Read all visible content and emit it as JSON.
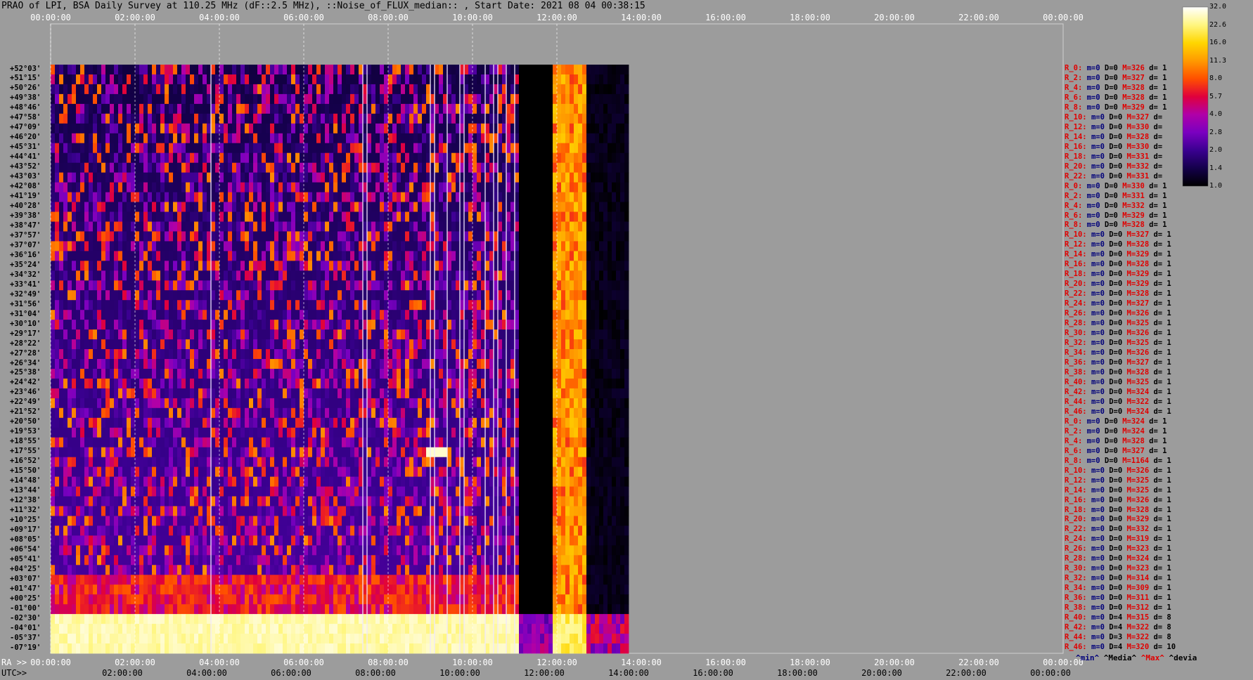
{
  "title": "PRAO of LPI, BSA Daily Survey at 110.25 MHz (dF::2.5 MHz), ::Noise_of_FLUX_median:: , Start Date: 2021 08 04 00:38:15",
  "axis": {
    "utc_top_ticks": [
      "00:00:00",
      "02:00:00",
      "04:00:00",
      "06:00:00",
      "08:00:00",
      "10:00:00",
      "12:00:00",
      "14:00:00",
      "16:00:00",
      "18:00:00",
      "20:00:00",
      "22:00:00",
      "00:00:00"
    ],
    "utc_bottom_prefix": "RA >>",
    "utc_bottom_ticks": [
      "00:00:00",
      "02:00:00",
      "04:00:00",
      "06:00:00",
      "08:00:00",
      "10:00:00",
      "12:00:00",
      "14:00:00",
      "16:00:00",
      "18:00:00",
      "20:00:00",
      "22:00:00",
      "00:00:00"
    ],
    "lst_prefix": "UTC>>",
    "lst_ticks": [
      "02:00:00",
      "04:00:00",
      "06:00:00",
      "08:00:00",
      "10:00:00",
      "12:00:00",
      "14:00:00",
      "16:00:00",
      "18:00:00",
      "20:00:00",
      "22:00:00",
      "00:00:00"
    ]
  },
  "declinations": [
    "+52°03'",
    "+51°15'",
    "+50°26'",
    "+49°38'",
    "+48°46'",
    "+47°58'",
    "+47°09'",
    "+46°20'",
    "+45°31'",
    "+44°41'",
    "+43°52'",
    "+43°03'",
    "+42°08'",
    "+41°19'",
    "+40°28'",
    "+39°38'",
    "+38°47'",
    "+37°57'",
    "+37°07'",
    "+36°16'",
    "+35°24'",
    "+34°32'",
    "+33°41'",
    "+32°49'",
    "+31°56'",
    "+31°04'",
    "+30°10'",
    "+29°17'",
    "+28°22'",
    "+27°28'",
    "+26°34'",
    "+25°38'",
    "+24°42'",
    "+23°46'",
    "+22°49'",
    "+21°52'",
    "+20°50'",
    "+19°53'",
    "+18°55'",
    "+17°55'",
    "+16°52'",
    "+15°50'",
    "+14°48'",
    "+13°44'",
    "+12°38'",
    "+11°32'",
    "+10°25'",
    "+09°17'",
    "+08°05'",
    "+06°54'",
    "+05°41'",
    "+04°25'",
    "+03°07'",
    "+01°47'",
    "+00°25'",
    "-01°00'",
    "-02°30'",
    "-04°01'",
    "-05°37'",
    "-07°19'"
  ],
  "row_stats": [
    {
      "r": "R_0:",
      "m": "m=0",
      "D": "D=0",
      "M": "M=326",
      "d": "d= 1"
    },
    {
      "r": "R_2:",
      "m": "m=0",
      "D": "D=0",
      "M": "M=327",
      "d": "d= 1"
    },
    {
      "r": "R_4:",
      "m": "m=0",
      "D": "D=0",
      "M": "M=328",
      "d": "d= 1"
    },
    {
      "r": "R_6:",
      "m": "m=0",
      "D": "D=0",
      "M": "M=328",
      "d": "d= 1"
    },
    {
      "r": "R_8:",
      "m": "m=0",
      "D": "D=0",
      "M": "M=329",
      "d": "d= 1"
    },
    {
      "r": "R_10:",
      "m": "m=0",
      "D": "D=0",
      "M": "M=327",
      "d": "d="
    },
    {
      "r": "R_12:",
      "m": "m=0",
      "D": "D=0",
      "M": "M=330",
      "d": "d="
    },
    {
      "r": "R_14:",
      "m": "m=0",
      "D": "D=0",
      "M": "M=328",
      "d": "d="
    },
    {
      "r": "R_16:",
      "m": "m=0",
      "D": "D=0",
      "M": "M=330",
      "d": "d="
    },
    {
      "r": "R_18:",
      "m": "m=0",
      "D": "D=0",
      "M": "M=331",
      "d": "d="
    },
    {
      "r": "R_20:",
      "m": "m=0",
      "D": "D=0",
      "M": "M=332",
      "d": "d="
    },
    {
      "r": "R_22:",
      "m": "m=0",
      "D": "D=0",
      "M": "M=331",
      "d": "d="
    },
    {
      "r": "R_0:",
      "m": "m=0",
      "D": "D=0",
      "M": "M=330",
      "d": "d= 1"
    },
    {
      "r": "R_2:",
      "m": "m=0",
      "D": "D=0",
      "M": "M=331",
      "d": "d= 1"
    },
    {
      "r": "R_4:",
      "m": "m=0",
      "D": "D=0",
      "M": "M=332",
      "d": "d= 1"
    },
    {
      "r": "R_6:",
      "m": "m=0",
      "D": "D=0",
      "M": "M=329",
      "d": "d= 1"
    },
    {
      "r": "R_8:",
      "m": "m=0",
      "D": "D=0",
      "M": "M=328",
      "d": "d= 1"
    },
    {
      "r": "R_10:",
      "m": "m=0",
      "D": "D=0",
      "M": "M=327",
      "d": "d= 1"
    },
    {
      "r": "R_12:",
      "m": "m=0",
      "D": "D=0",
      "M": "M=328",
      "d": "d= 1"
    },
    {
      "r": "R_14:",
      "m": "m=0",
      "D": "D=0",
      "M": "M=329",
      "d": "d= 1"
    },
    {
      "r": "R_16:",
      "m": "m=0",
      "D": "D=0",
      "M": "M=328",
      "d": "d= 1"
    },
    {
      "r": "R_18:",
      "m": "m=0",
      "D": "D=0",
      "M": "M=329",
      "d": "d= 1"
    },
    {
      "r": "R_20:",
      "m": "m=0",
      "D": "D=0",
      "M": "M=329",
      "d": "d= 1"
    },
    {
      "r": "R_22:",
      "m": "m=0",
      "D": "D=0",
      "M": "M=328",
      "d": "d= 1"
    },
    {
      "r": "R_24:",
      "m": "m=0",
      "D": "D=0",
      "M": "M=327",
      "d": "d= 1"
    },
    {
      "r": "R_26:",
      "m": "m=0",
      "D": "D=0",
      "M": "M=326",
      "d": "d= 1"
    },
    {
      "r": "R_28:",
      "m": "m=0",
      "D": "D=0",
      "M": "M=325",
      "d": "d= 1"
    },
    {
      "r": "R_30:",
      "m": "m=0",
      "D": "D=0",
      "M": "M=326",
      "d": "d= 1"
    },
    {
      "r": "R_32:",
      "m": "m=0",
      "D": "D=0",
      "M": "M=325",
      "d": "d= 1"
    },
    {
      "r": "R_34:",
      "m": "m=0",
      "D": "D=0",
      "M": "M=326",
      "d": "d= 1"
    },
    {
      "r": "R_36:",
      "m": "m=0",
      "D": "D=0",
      "M": "M=327",
      "d": "d= 1"
    },
    {
      "r": "R_38:",
      "m": "m=0",
      "D": "D=0",
      "M": "M=328",
      "d": "d= 1"
    },
    {
      "r": "R_40:",
      "m": "m=0",
      "D": "D=0",
      "M": "M=325",
      "d": "d= 1"
    },
    {
      "r": "R_42:",
      "m": "m=0",
      "D": "D=0",
      "M": "M=324",
      "d": "d= 1"
    },
    {
      "r": "R_44:",
      "m": "m=0",
      "D": "D=0",
      "M": "M=322",
      "d": "d= 1"
    },
    {
      "r": "R_46:",
      "m": "m=0",
      "D": "D=0",
      "M": "M=324",
      "d": "d= 1"
    },
    {
      "r": "R_0:",
      "m": "m=0",
      "D": "D=0",
      "M": "M=324",
      "d": "d= 1"
    },
    {
      "r": "R_2:",
      "m": "m=0",
      "D": "D=0",
      "M": "M=324",
      "d": "d= 1"
    },
    {
      "r": "R_4:",
      "m": "m=0",
      "D": "D=0",
      "M": "M=328",
      "d": "d= 1"
    },
    {
      "r": "R_6:",
      "m": "m=0",
      "D": "D=0",
      "M": "M=327",
      "d": "d= 1"
    },
    {
      "r": "R_8:",
      "m": "m=0",
      "D": "D=0",
      "M": "M=1164",
      "d": "d= 1"
    },
    {
      "r": "R_10:",
      "m": "m=0",
      "D": "D=0",
      "M": "M=326",
      "d": "d= 1"
    },
    {
      "r": "R_12:",
      "m": "m=0",
      "D": "D=0",
      "M": "M=325",
      "d": "d= 1"
    },
    {
      "r": "R_14:",
      "m": "m=0",
      "D": "D=0",
      "M": "M=325",
      "d": "d= 1"
    },
    {
      "r": "R_16:",
      "m": "m=0",
      "D": "D=0",
      "M": "M=326",
      "d": "d= 1"
    },
    {
      "r": "R_18:",
      "m": "m=0",
      "D": "D=0",
      "M": "M=328",
      "d": "d= 1"
    },
    {
      "r": "R_20:",
      "m": "m=0",
      "D": "D=0",
      "M": "M=329",
      "d": "d= 1"
    },
    {
      "r": "R_22:",
      "m": "m=0",
      "D": "D=0",
      "M": "M=332",
      "d": "d= 1"
    },
    {
      "r": "R_24:",
      "m": "m=0",
      "D": "D=0",
      "M": "M=319",
      "d": "d= 1"
    },
    {
      "r": "R_26:",
      "m": "m=0",
      "D": "D=0",
      "M": "M=323",
      "d": "d= 1"
    },
    {
      "r": "R_28:",
      "m": "m=0",
      "D": "D=0",
      "M": "M=324",
      "d": "d= 1"
    },
    {
      "r": "R_30:",
      "m": "m=0",
      "D": "D=0",
      "M": "M=323",
      "d": "d= 1"
    },
    {
      "r": "R_32:",
      "m": "m=0",
      "D": "D=0",
      "M": "M=314",
      "d": "d= 1"
    },
    {
      "r": "R_34:",
      "m": "m=0",
      "D": "D=0",
      "M": "M=309",
      "d": "d= 1"
    },
    {
      "r": "R_36:",
      "m": "m=0",
      "D": "D=0",
      "M": "M=311",
      "d": "d= 1"
    },
    {
      "r": "R_38:",
      "m": "m=0",
      "D": "D=0",
      "M": "M=312",
      "d": "d= 1"
    },
    {
      "r": "R_40:",
      "m": "m=0",
      "D": "D=4",
      "M": "M=315",
      "d": "d= 8"
    },
    {
      "r": "R_42:",
      "m": "m=0",
      "D": "D=4",
      "M": "M=322",
      "d": "d= 8"
    },
    {
      "r": "R_44:",
      "m": "m=0",
      "D": "D=3",
      "M": "M=322",
      "d": "d= 8"
    },
    {
      "r": "R_46:",
      "m": "m=0",
      "D": "D=4",
      "M": "M=320",
      "d": "d= 10"
    }
  ],
  "stats_footer": {
    "min": "^min^",
    "median": "^Media^",
    "max": "^Max^",
    "devia": "^devia"
  },
  "colorbar": {
    "ticks": [
      "32.0",
      "22.6",
      "16.0",
      "11.3",
      "8.0",
      "5.7",
      "4.0",
      "2.8",
      "2.0",
      "1.4",
      "1.0"
    ],
    "colors": [
      "#000000",
      "#14004a",
      "#3a0090",
      "#7a00c0",
      "#b000a8",
      "#e0003c",
      "#ff5000",
      "#ff9a00",
      "#ffd600",
      "#fff680",
      "#ffffff"
    ]
  },
  "chart_data": {
    "type": "heatmap",
    "title": "PRAO of LPI, BSA Daily Survey at 110.25 MHz (dF::2.5 MHz), ::Noise_of_FLUX_median:: , Start Date: 2021 08 04 00:38:15",
    "x_axis": "UTC / RA (hours)",
    "x_range": [
      "00:00:00",
      "00:00:00"
    ],
    "data_extent_hours": [
      0,
      13.7
    ],
    "y_rows": 60,
    "color_scale": {
      "min": 1.0,
      "max": 32.0,
      "scale": "log"
    },
    "features": {
      "black_gap_hours": [
        11.1,
        11.9
      ],
      "bright_band_hours": [
        11.9,
        12.7
      ],
      "bright_bottom_rows_from_dec": "-02°30'",
      "bright_bottom_level": 22.6,
      "bright_point_source_hours": 9.1,
      "bright_point_source_dec": "+17°55'"
    },
    "vertical_spikes_hours": [
      3.8,
      7.4,
      7.5,
      9.0,
      9.1,
      9.4,
      9.7,
      9.8,
      10.3,
      10.5,
      10.6,
      10.8,
      11.0
    ]
  }
}
